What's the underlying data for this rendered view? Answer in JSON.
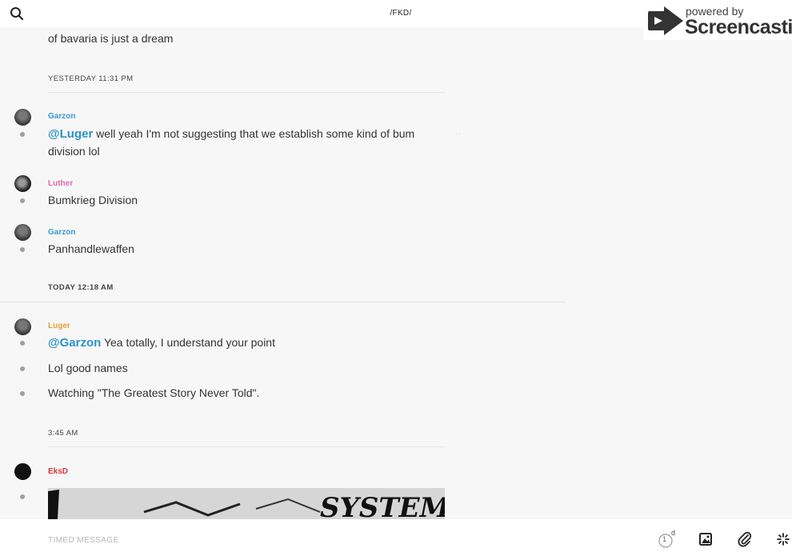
{
  "topbar": {
    "channel_title": "/FKD/",
    "search_icon": "search-icon"
  },
  "watermark": {
    "powered_by": "powered by",
    "brand": "Screencastify"
  },
  "feed": {
    "truncated_message": "of bavaria is just a dream",
    "groups": [
      {
        "timestamp": "YESTERDAY 11:31 PM"
      },
      {
        "timestamp": "TODAY 12:18 AM"
      },
      {
        "timestamp": "3:45 AM"
      }
    ],
    "messages": [
      {
        "author": "Garzon",
        "author_color": "#3a9bd0",
        "mention": "@Luger",
        "text": " well yeah I'm not suggesting that we establish some kind of bum",
        "text_cont": "division lol"
      },
      {
        "author": "Luther",
        "author_color": "#e06aa8",
        "text": "Bumkrieg Division"
      },
      {
        "author": "Garzon",
        "author_color": "#3a9bd0",
        "text": "Panhandlewaffen"
      },
      {
        "author": "Luger",
        "author_color": "#e8a13a",
        "mention": "@Garzon",
        "text": "  Yea totally, I understand your point"
      },
      {
        "text": "Lol good names"
      },
      {
        "text": "Watching  \"The Greatest Story Never Told\"."
      },
      {
        "author": "EksD",
        "author_color": "#d9363e",
        "image_text": "SYSTEMS"
      }
    ]
  },
  "composer": {
    "placeholder": "TIMED MESSAGE",
    "timer_count": "1",
    "timer_unit": "d"
  },
  "colors": {
    "mention": "#2d93c9",
    "background": "#f7f7f7"
  }
}
